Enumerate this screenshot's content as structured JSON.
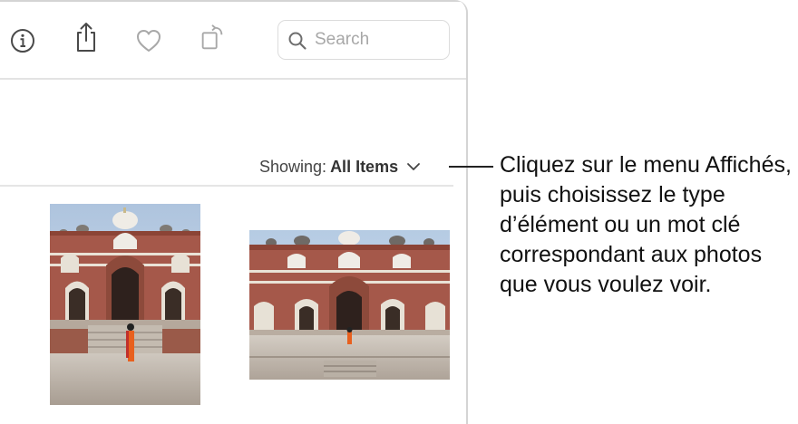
{
  "toolbar": {
    "icons": [
      "info-icon",
      "share-icon",
      "heart-icon",
      "rotate-icon"
    ],
    "search": {
      "placeholder": "Search",
      "value": ""
    }
  },
  "filter": {
    "label": "Showing:",
    "value": "All Items"
  },
  "photos": [
    {
      "name": "Humayun's Tomb (portrait)"
    },
    {
      "name": "Humayun's Tomb (landscape)"
    }
  ],
  "callout": {
    "text": "Cliquez sur le menu Affichés, puis choisissez le type d’élément ou un mot clé correspondant aux photos que vous voulez voir."
  },
  "colors": {
    "sky": "#c9d6e6",
    "sandstone": "#a5584a",
    "marble": "#efece6",
    "ground": "#b7aea3",
    "dress": "#e8601e"
  }
}
